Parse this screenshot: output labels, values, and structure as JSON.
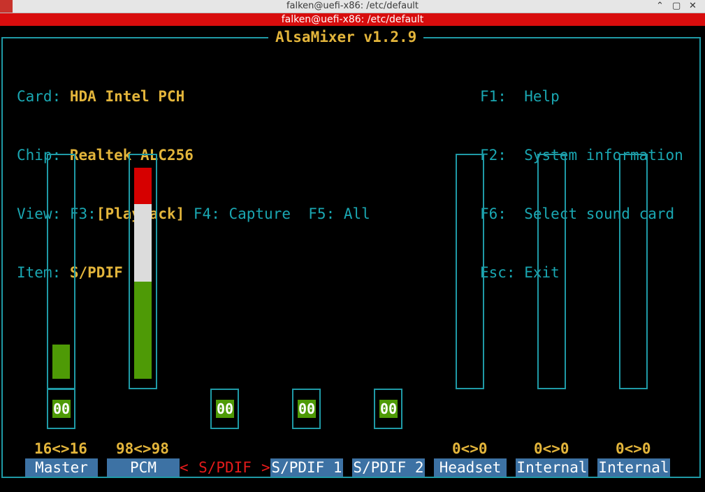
{
  "window": {
    "title": "falken@uefi-x86: /etc/default",
    "tab_title": "falken@uefi-x86: /etc/default",
    "controls": [
      "⌃",
      "▢",
      "✕"
    ]
  },
  "mixer": {
    "title": "AlsaMixer v1.2.9",
    "card_label": "Card:",
    "card_value": "HDA Intel PCH",
    "chip_label": "Chip:",
    "chip_value": "Realtek ALC256",
    "view_label": "View:",
    "view_f3_key": "F3:",
    "view_f3_value": "[Playback]",
    "view_f4": "F4: Capture",
    "view_f5": "F5: All",
    "item_label": "Item:",
    "item_value": "S/PDIF",
    "help": [
      {
        "key": "F1:",
        "label": "Help"
      },
      {
        "key": "F2:",
        "label": "System information"
      },
      {
        "key": "F6:",
        "label": "Select sound card"
      },
      {
        "key": "Esc:",
        "label": "Exit"
      }
    ]
  },
  "channels": [
    {
      "name": "Master",
      "value": "16<>16",
      "level": 0.16,
      "mute": "00",
      "selected": false
    },
    {
      "name": "PCM",
      "value": "98<>98",
      "level": 0.98,
      "mute": "",
      "selected": false
    },
    {
      "name": "S/PDIF",
      "value": "",
      "level": null,
      "mute": "00",
      "selected": true
    },
    {
      "name": "S/PDIF 1",
      "value": "",
      "level": null,
      "mute": "00",
      "selected": false
    },
    {
      "name": "S/PDIF 2",
      "value": "",
      "level": null,
      "mute": "00",
      "selected": false
    },
    {
      "name": "Headset",
      "value": "0<>0",
      "level": 0,
      "mute": "",
      "selected": false
    },
    {
      "name": "Internal",
      "value": "0<>0",
      "level": 0,
      "mute": "",
      "selected": false
    },
    {
      "name": "Internal",
      "value": "0<>0",
      "level": 0,
      "mute": "",
      "selected": false
    }
  ],
  "selection_markers": {
    "left": "<",
    "right": ">"
  },
  "colors": {
    "frame": "#1f9aa6",
    "label": "#1aa7b2",
    "value": "#e3b53b",
    "chip": "#3d72a4",
    "active": "#e51b1b",
    "green": "#4e9a06",
    "white": "#dcdcdc",
    "red": "#d60000"
  }
}
